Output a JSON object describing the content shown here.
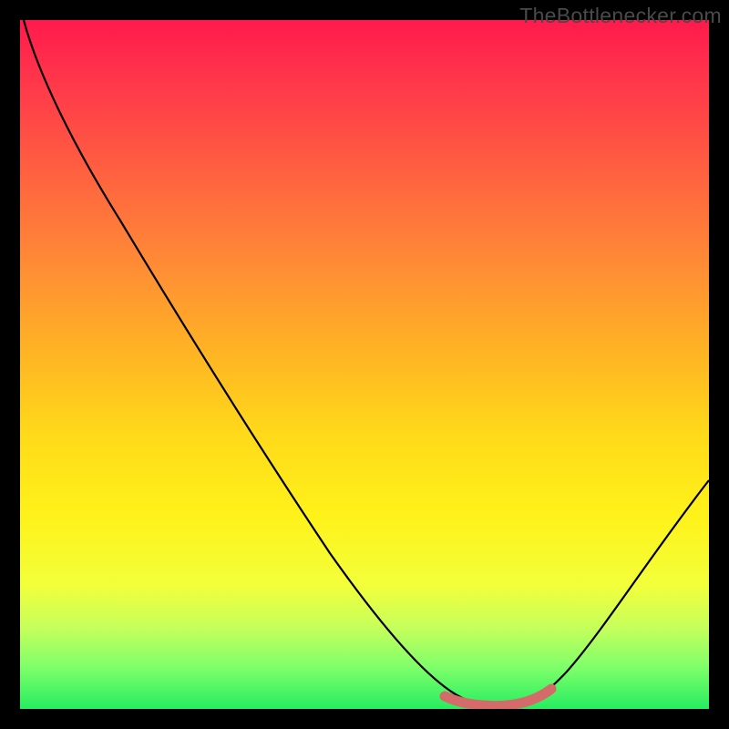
{
  "watermark": "TheBottlenecker.com",
  "chart_data": {
    "type": "line",
    "title": "",
    "xlabel": "",
    "ylabel": "",
    "xlim": [
      0,
      100
    ],
    "ylim": [
      0,
      100
    ],
    "gradient_stops": [
      {
        "pct": 0,
        "color": "#ff1a4d"
      },
      {
        "pct": 22,
        "color": "#ff6a3e"
      },
      {
        "pct": 48,
        "color": "#ffb324"
      },
      {
        "pct": 72,
        "color": "#fff21a"
      },
      {
        "pct": 88,
        "color": "#c8ff5a"
      },
      {
        "pct": 100,
        "color": "#25ed60"
      }
    ],
    "series": [
      {
        "name": "bottleneck-curve",
        "color": "#000000",
        "points": [
          {
            "x": 0,
            "y": 99
          },
          {
            "x": 5,
            "y": 93
          },
          {
            "x": 12,
            "y": 82
          },
          {
            "x": 20,
            "y": 70
          },
          {
            "x": 28,
            "y": 58
          },
          {
            "x": 36,
            "y": 45
          },
          {
            "x": 44,
            "y": 32
          },
          {
            "x": 52,
            "y": 19
          },
          {
            "x": 58,
            "y": 9
          },
          {
            "x": 62,
            "y": 3
          },
          {
            "x": 67,
            "y": 1
          },
          {
            "x": 72,
            "y": 1
          },
          {
            "x": 76,
            "y": 3
          },
          {
            "x": 82,
            "y": 10
          },
          {
            "x": 88,
            "y": 19
          },
          {
            "x": 94,
            "y": 29
          },
          {
            "x": 100,
            "y": 40
          }
        ]
      },
      {
        "name": "optimal-range-marker",
        "color": "#d86a6a",
        "stroke_width": 9,
        "points": [
          {
            "x": 62,
            "y": 2
          },
          {
            "x": 65,
            "y": 1.2
          },
          {
            "x": 68,
            "y": 1
          },
          {
            "x": 71,
            "y": 1
          },
          {
            "x": 74,
            "y": 1.5
          },
          {
            "x": 77,
            "y": 3
          }
        ]
      }
    ]
  }
}
